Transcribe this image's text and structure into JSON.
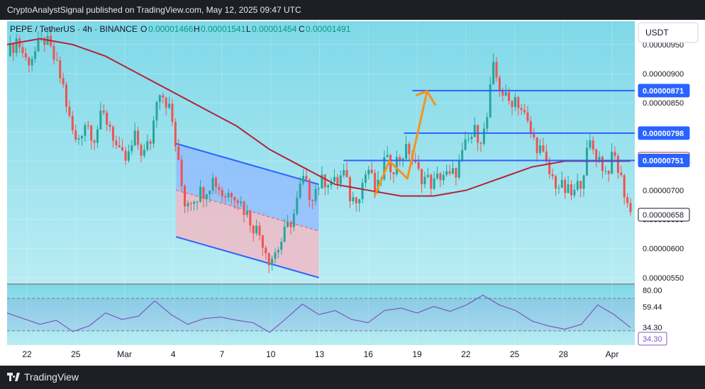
{
  "header": {
    "publisher_text": "CryptoAnalystSignal published on TradingView.com, May 12, 2025 09:47 UTC"
  },
  "footer": {
    "brand": "TradingView"
  },
  "symbol_bar": {
    "symbol": "PEPE / TetherUS · 4h · BINANCE",
    "o_label": "O",
    "o_value": "0.00001466",
    "h_label": "H",
    "h_value": "0.00001541",
    "l_label": "L",
    "l_value": "0.00001454",
    "c_label": "C",
    "c_value": "0.00001491"
  },
  "currency_button": "USDT",
  "colors": {
    "bg_top": "#7fd8e8",
    "bg_bottom": "#b9ecf3",
    "candle_up": "#26a69a",
    "candle_down": "#ef5350",
    "ma": "#b0263a",
    "level_line": "#2962ff",
    "arrow": "#f7931a",
    "channel_blue": "#90b8ff",
    "channel_red": "#f4b8c4",
    "rsi": "#7e57c2"
  },
  "chart_data": {
    "type": "candlestick",
    "x_ticks": [
      "22",
      "25",
      "Mar",
      "4",
      "7",
      "10",
      "13",
      "16",
      "19",
      "22",
      "25",
      "28",
      "Apr"
    ],
    "y_ticks": [
      9.5e-06,
      9e-06,
      8.5e-06,
      8e-06,
      7.5e-06,
      7e-06,
      6.5e-06,
      6e-06,
      5.5e-06
    ],
    "y_tick_labels": [
      "0.00000950",
      "0.00000900",
      "0.00000850",
      "0.00000800",
      "0.00000750",
      "0.00000700",
      "0.00000650",
      "0.00000600",
      "0.00000550"
    ],
    "ylim": [
      5.4e-06,
      9.9e-06
    ],
    "price_tags": [
      {
        "label": "0.00000871",
        "value": 8.71e-06,
        "style": "blue"
      },
      {
        "label": "0.00000798",
        "value": 7.98e-06,
        "style": "blue"
      },
      {
        "label": "0.00000754",
        "value": 7.54e-06,
        "style": "ma"
      },
      {
        "label": "0.00000751",
        "value": 7.51e-06,
        "style": "blue"
      },
      {
        "label": "0.00000658",
        "value": 6.58e-06,
        "style": "last"
      }
    ],
    "horizontal_levels": [
      8.71e-06,
      7.98e-06,
      7.51e-06
    ],
    "close_path": [
      {
        "x": 0,
        "y": 9.3e-06
      },
      {
        "x": 0.6,
        "y": 9.6e-06
      },
      {
        "x": 1.2,
        "y": 9.2e-06
      },
      {
        "x": 1.8,
        "y": 9.4e-06
      },
      {
        "x": 2.3,
        "y": 9.6e-06
      },
      {
        "x": 2.8,
        "y": 9.3e-06
      },
      {
        "x": 3.4,
        "y": 8.8e-06
      },
      {
        "x": 3.8,
        "y": 8.2e-06
      },
      {
        "x": 4.2,
        "y": 7.8e-06
      },
      {
        "x": 4.8,
        "y": 8.2e-06
      },
      {
        "x": 5.3,
        "y": 7.9e-06
      },
      {
        "x": 5.8,
        "y": 8.3e-06
      },
      {
        "x": 6.3,
        "y": 8.1e-06
      },
      {
        "x": 6.8,
        "y": 7.6e-06
      },
      {
        "x": 7.3,
        "y": 7.5e-06
      },
      {
        "x": 7.8,
        "y": 7.9e-06
      },
      {
        "x": 8.3,
        "y": 7.6e-06
      },
      {
        "x": 8.8,
        "y": 7.9e-06
      },
      {
        "x": 9.2,
        "y": 8.8e-06
      },
      {
        "x": 9.6,
        "y": 8.6e-06
      },
      {
        "x": 10,
        "y": 8.3e-06
      },
      {
        "x": 10.4,
        "y": 7.5e-06
      },
      {
        "x": 10.8,
        "y": 6.8e-06
      },
      {
        "x": 11.4,
        "y": 6.9e-06
      },
      {
        "x": 12,
        "y": 7e-06
      },
      {
        "x": 12.6,
        "y": 7.2e-06
      },
      {
        "x": 13.2,
        "y": 6.9e-06
      },
      {
        "x": 13.8,
        "y": 7e-06
      },
      {
        "x": 14.4,
        "y": 6.7e-06
      },
      {
        "x": 15,
        "y": 6.4e-06
      },
      {
        "x": 15.5,
        "y": 6.2e-06
      },
      {
        "x": 16,
        "y": 5.8e-06
      },
      {
        "x": 16.5,
        "y": 6e-06
      },
      {
        "x": 17,
        "y": 6.3e-06
      },
      {
        "x": 17.5,
        "y": 6.6e-06
      },
      {
        "x": 18,
        "y": 7.2e-06
      },
      {
        "x": 18.5,
        "y": 6.9e-06
      },
      {
        "x": 19,
        "y": 7.1e-06
      },
      {
        "x": 19.5,
        "y": 7.2e-06
      },
      {
        "x": 20,
        "y": 7.1e-06
      },
      {
        "x": 20.5,
        "y": 7.3e-06
      },
      {
        "x": 21,
        "y": 6.8e-06
      },
      {
        "x": 21.5,
        "y": 7e-06
      },
      {
        "x": 22,
        "y": 7.4e-06
      },
      {
        "x": 22.5,
        "y": 6.9e-06
      },
      {
        "x": 23,
        "y": 7.5e-06
      },
      {
        "x": 23.5,
        "y": 7.4e-06
      },
      {
        "x": 24,
        "y": 7.6e-06
      },
      {
        "x": 24.5,
        "y": 7.7e-06
      },
      {
        "x": 25,
        "y": 7.3e-06
      },
      {
        "x": 25.5,
        "y": 7.2e-06
      },
      {
        "x": 26,
        "y": 7.1e-06
      },
      {
        "x": 26.5,
        "y": 7.3e-06
      },
      {
        "x": 27,
        "y": 7.2e-06
      },
      {
        "x": 27.5,
        "y": 7.4e-06
      },
      {
        "x": 28,
        "y": 7.8e-06
      },
      {
        "x": 28.5,
        "y": 8e-06
      },
      {
        "x": 29,
        "y": 7.9e-06
      },
      {
        "x": 29.3,
        "y": 8.3e-06
      },
      {
        "x": 29.6,
        "y": 9.1e-06
      },
      {
        "x": 30,
        "y": 8.8e-06
      },
      {
        "x": 30.5,
        "y": 8.5e-06
      },
      {
        "x": 31,
        "y": 8.6e-06
      },
      {
        "x": 31.5,
        "y": 8.3e-06
      },
      {
        "x": 32,
        "y": 7.9e-06
      },
      {
        "x": 32.5,
        "y": 7.7e-06
      },
      {
        "x": 33,
        "y": 7.3e-06
      },
      {
        "x": 33.5,
        "y": 7.1e-06
      },
      {
        "x": 34,
        "y": 7e-06
      },
      {
        "x": 34.5,
        "y": 6.9e-06
      },
      {
        "x": 35,
        "y": 7.2e-06
      },
      {
        "x": 35.5,
        "y": 7.8e-06
      },
      {
        "x": 36,
        "y": 7.6e-06
      },
      {
        "x": 36.5,
        "y": 7.3e-06
      },
      {
        "x": 37,
        "y": 7.6e-06
      },
      {
        "x": 37.5,
        "y": 7.1e-06
      },
      {
        "x": 38,
        "y": 6.6e-06
      }
    ],
    "ma_path": [
      {
        "x": 0,
        "y": 9.5e-06
      },
      {
        "x": 2,
        "y": 9.6e-06
      },
      {
        "x": 4,
        "y": 9.5e-06
      },
      {
        "x": 6,
        "y": 9.3e-06
      },
      {
        "x": 8,
        "y": 9e-06
      },
      {
        "x": 10,
        "y": 8.7e-06
      },
      {
        "x": 12,
        "y": 8.4e-06
      },
      {
        "x": 14,
        "y": 8.1e-06
      },
      {
        "x": 16,
        "y": 7.7e-06
      },
      {
        "x": 18,
        "y": 7.4e-06
      },
      {
        "x": 20,
        "y": 7.1e-06
      },
      {
        "x": 22,
        "y": 7e-06
      },
      {
        "x": 24,
        "y": 6.9e-06
      },
      {
        "x": 26,
        "y": 6.9e-06
      },
      {
        "x": 28,
        "y": 7e-06
      },
      {
        "x": 30,
        "y": 7.2e-06
      },
      {
        "x": 32,
        "y": 7.4e-06
      },
      {
        "x": 34,
        "y": 7.5e-06
      },
      {
        "x": 36,
        "y": 7.5e-06
      },
      {
        "x": 38,
        "y": 7.5e-06
      }
    ],
    "channel_upper": [
      {
        "x": 10.3,
        "y": 7.8e-06
      },
      {
        "x": 19,
        "y": 7.1e-06
      }
    ],
    "channel_lower": [
      {
        "x": 10.3,
        "y": 6.2e-06
      },
      {
        "x": 19,
        "y": 5.5e-06
      }
    ],
    "channel_mid": [
      {
        "x": 10.3,
        "y": 7e-06
      },
      {
        "x": 19,
        "y": 6.3e-06
      }
    ],
    "channel_right_x": 19,
    "arrow_path": [
      {
        "x": 22.4,
        "y": 6.9e-06
      },
      {
        "x": 23.3,
        "y": 7.5e-06
      },
      {
        "x": 24.4,
        "y": 7.2e-06
      },
      {
        "x": 25.6,
        "y": 8.7e-06
      }
    ],
    "level_start_x": [
      24.7,
      24.2,
      20.5
    ],
    "rsi": {
      "ticks": [
        80,
        59.44,
        34.3
      ],
      "tick_labels": [
        "80.00",
        "59.44",
        "34.30"
      ],
      "value_label": "34.30",
      "upper_band": 70,
      "lower_band": 30,
      "ylim": [
        15,
        85
      ],
      "path": [
        {
          "x": 0,
          "y": 52
        },
        {
          "x": 1,
          "y": 45
        },
        {
          "x": 2,
          "y": 38
        },
        {
          "x": 3,
          "y": 43
        },
        {
          "x": 4,
          "y": 29
        },
        {
          "x": 5,
          "y": 36
        },
        {
          "x": 6,
          "y": 52
        },
        {
          "x": 7,
          "y": 44
        },
        {
          "x": 8,
          "y": 48
        },
        {
          "x": 9,
          "y": 67
        },
        {
          "x": 10,
          "y": 50
        },
        {
          "x": 11,
          "y": 38
        },
        {
          "x": 12,
          "y": 45
        },
        {
          "x": 13,
          "y": 47
        },
        {
          "x": 14,
          "y": 43
        },
        {
          "x": 15,
          "y": 40
        },
        {
          "x": 16,
          "y": 28
        },
        {
          "x": 17,
          "y": 45
        },
        {
          "x": 18,
          "y": 63
        },
        {
          "x": 19,
          "y": 50
        },
        {
          "x": 20,
          "y": 55
        },
        {
          "x": 21,
          "y": 44
        },
        {
          "x": 22,
          "y": 40
        },
        {
          "x": 23,
          "y": 55
        },
        {
          "x": 24,
          "y": 58
        },
        {
          "x": 25,
          "y": 52
        },
        {
          "x": 26,
          "y": 60
        },
        {
          "x": 27,
          "y": 54
        },
        {
          "x": 28,
          "y": 62
        },
        {
          "x": 29,
          "y": 74
        },
        {
          "x": 30,
          "y": 62
        },
        {
          "x": 31,
          "y": 55
        },
        {
          "x": 32,
          "y": 42
        },
        {
          "x": 33,
          "y": 36
        },
        {
          "x": 34,
          "y": 32
        },
        {
          "x": 35,
          "y": 38
        },
        {
          "x": 36,
          "y": 62
        },
        {
          "x": 37,
          "y": 50
        },
        {
          "x": 38,
          "y": 34
        }
      ]
    }
  }
}
